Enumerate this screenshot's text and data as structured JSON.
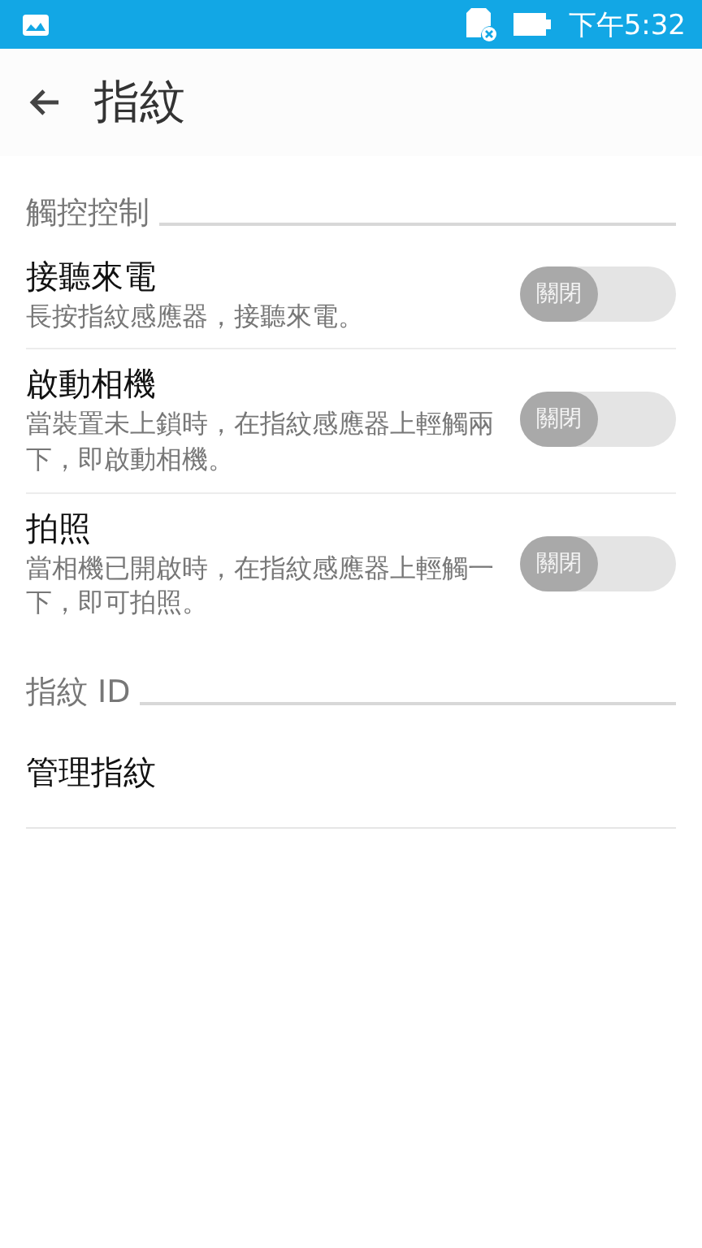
{
  "status_bar": {
    "time": "下午5:32"
  },
  "header": {
    "title": "指紋"
  },
  "sections": [
    {
      "title": "觸控控制",
      "items": [
        {
          "kind": "toggle",
          "title": "接聽來電",
          "description": "長按指紋感應器，接聽來電。",
          "toggle": {
            "on": false,
            "label": "關閉"
          }
        },
        {
          "kind": "toggle",
          "title": "啟動相機",
          "description": "當裝置未上鎖時，在指紋感應器上輕觸兩下，即啟動相機。",
          "toggle": {
            "on": false,
            "label": "關閉"
          }
        },
        {
          "kind": "toggle",
          "title": "拍照",
          "description": "當相機已開啟時，在指紋感應器上輕觸一下，即可拍照。",
          "toggle": {
            "on": false,
            "label": "關閉"
          }
        }
      ]
    },
    {
      "title": "指紋 ID",
      "items": [
        {
          "kind": "link",
          "title": "管理指紋"
        }
      ]
    }
  ]
}
